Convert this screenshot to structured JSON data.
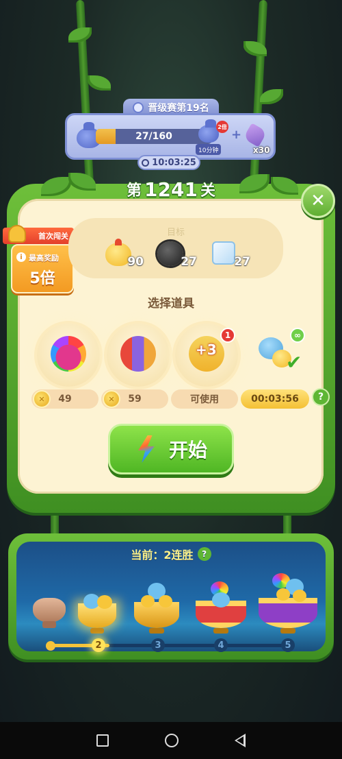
{
  "rank": {
    "label": "晋级赛第19名",
    "progress_text": "27/160",
    "progress_value": 0.17,
    "multiplier_badge": "2倍",
    "time_chip": "10分钟",
    "reward_count": "x30",
    "plus": "+",
    "countdown": "10:03:25",
    "icons": [
      "medal-icon",
      "reward-bag-icon",
      "shovel-icon",
      "clock-icon"
    ]
  },
  "level": {
    "prefix": "第",
    "number": "1241",
    "suffix": "关",
    "close_label": "✕"
  },
  "first_clear": {
    "ribbon": "首次闯关",
    "info": "i",
    "reward_label": "最高奖励",
    "reward_value": "5倍"
  },
  "goals": {
    "label": "目标",
    "items": [
      {
        "name": "chick",
        "count": "90"
      },
      {
        "name": "furball",
        "count": "27"
      },
      {
        "name": "ice-cube",
        "count": "27"
      }
    ]
  },
  "tools": {
    "title": "选择道具",
    "items": [
      {
        "name": "rainbow-owl-booster",
        "price": "49"
      },
      {
        "name": "rocket-booster",
        "price": "59"
      },
      {
        "name": "plus3-swap-booster",
        "label": "+3",
        "badge": "1",
        "status": "可使用"
      },
      {
        "name": "buddy-booster",
        "badge": "∞",
        "timer": "00:03:56"
      }
    ],
    "help": "?"
  },
  "start_button": {
    "label": "开始"
  },
  "streak": {
    "title": "当前：2连胜",
    "help": "?",
    "progress_value": 0.25,
    "steps": [
      "2",
      "3",
      "4",
      "5"
    ]
  },
  "colors": {
    "vine_green": "#4e9a2d",
    "board_cream": "#fdf3d3",
    "start_green": "#4fb624",
    "streak_blue": "#1f6aa8"
  }
}
